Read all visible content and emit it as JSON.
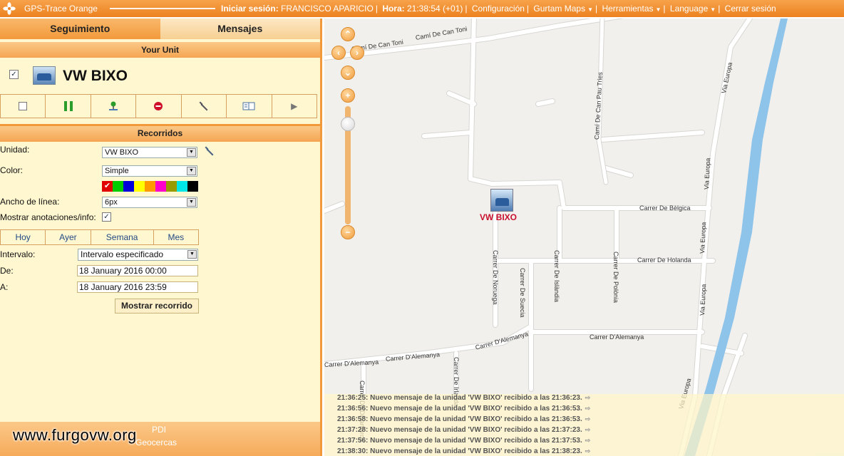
{
  "topbar": {
    "brand": "GPS-Trace Orange",
    "login_label": "Iniciar sesión:",
    "user": "FRANCISCO APARICIO",
    "time_label": "Hora:",
    "time_value": "21:38:54 (+01)",
    "menu": [
      "Configuración",
      "Gurtam Maps",
      "Herramientas",
      "Language",
      "Cerrar sesión"
    ],
    "menu_dropdown": [
      false,
      true,
      true,
      true,
      false
    ]
  },
  "tabs": [
    "Seguimiento",
    "Mensajes"
  ],
  "unit_panel": {
    "title": "Your Unit",
    "unit_name": "VW BIXO",
    "unit_checked": true,
    "toolbar_icons": [
      "checkbox-icon",
      "pause-icon",
      "locate-icon",
      "stop-icon",
      "wrench-icon",
      "book-icon",
      "play-icon"
    ]
  },
  "routes": {
    "title": "Recorridos",
    "unit_label": "Unidad:",
    "unit_value": "VW BIXO",
    "color_label": "Color:",
    "color_value": "Simple",
    "swatches": [
      "#e00000",
      "#00cc00",
      "#0000dd",
      "#ffff00",
      "#ff9900",
      "#ff00cc",
      "#999900",
      "#00e5e5",
      "#000000"
    ],
    "swatch_selected_mark": "✔",
    "line_width_label": "Ancho de línea:",
    "line_width_value": "6px",
    "annotations_label": "Mostrar anotaciones/info:",
    "annotations_checked": true,
    "periods": [
      "Hoy",
      "Ayer",
      "Semana",
      "Mes"
    ],
    "interval_label": "Intervalo:",
    "interval_value": "Intervalo especificado",
    "from_label": "De:",
    "from_value": "18 January 2016 00:00",
    "to_label": "A:",
    "to_value": "18 January 2016 23:59",
    "show_button": "Mostrar recorrido"
  },
  "bottom": {
    "items": [
      "PDI",
      "Geocercas"
    ],
    "watermark": "www.furgovw.org"
  },
  "map": {
    "marker_label": "VW BIXO",
    "streets": [
      "Camí De Can Toni",
      "Camí De Can Toni",
      "Camí De Can Pau Tries",
      "Via Europa",
      "Via Europa",
      "Via Europa",
      "Via Europa",
      "Via Europa",
      "Carrer De Bèlgica",
      "Carrer De Holanda",
      "Carrer De Islàndia",
      "Carrer De Polònia",
      "Carrer De Noruega",
      "Carrer De Suecia",
      "Carrer D'Alemanya",
      "Carrer D'Alemanya",
      "Carrer D'Alemanya",
      "Carrer D'Alemanya",
      "Carrer De Irlanda",
      "Carrer De Dinamarca"
    ],
    "messages": [
      {
        "time": "21:36:25",
        "text": "Nuevo mensaje de la unidad 'VW BIXO' recibido a las 21:36:23."
      },
      {
        "time": "21:36:56",
        "text": "Nuevo mensaje de la unidad 'VW BIXO' recibido a las 21:36:53."
      },
      {
        "time": "21:36:58",
        "text": "Nuevo mensaje de la unidad 'VW BIXO' recibido a las 21:36:53."
      },
      {
        "time": "21:37:28",
        "text": "Nuevo mensaje de la unidad 'VW BIXO' recibido a las 21:37:23."
      },
      {
        "time": "21:37:56",
        "text": "Nuevo mensaje de la unidad 'VW BIXO' recibido a las 21:37:53."
      },
      {
        "time": "21:38:30",
        "text": "Nuevo mensaje de la unidad 'VW BIXO' recibido a las 21:38:23."
      }
    ]
  }
}
